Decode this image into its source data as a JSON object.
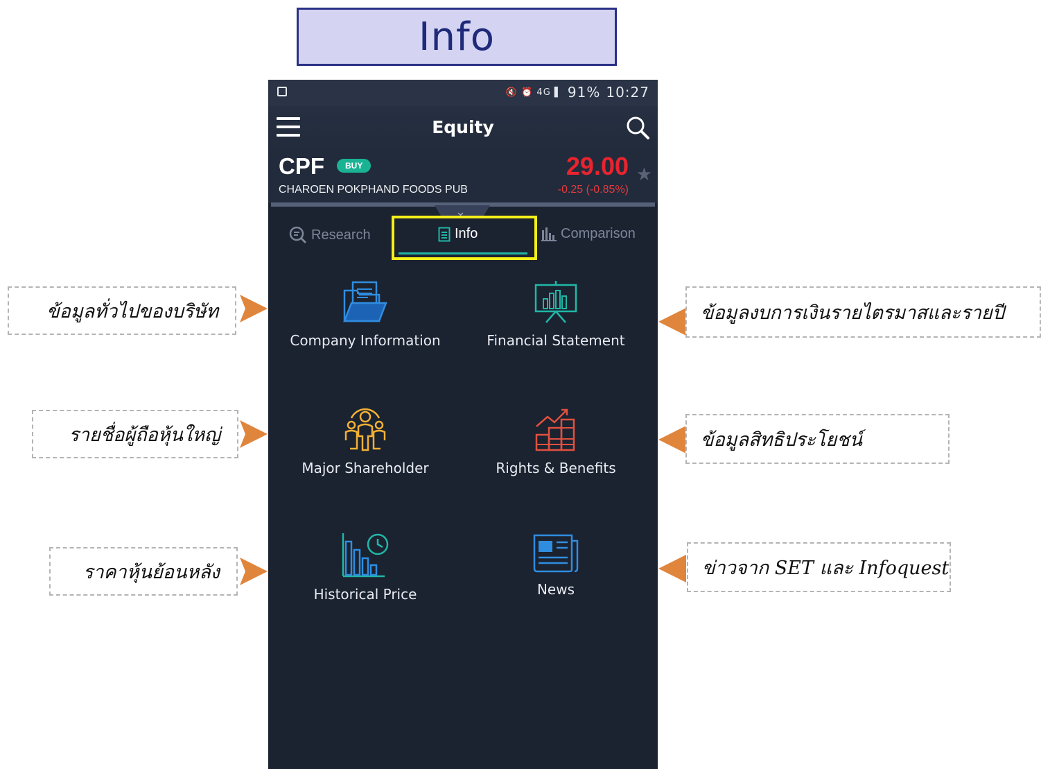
{
  "banner": {
    "title": "Info"
  },
  "status_bar": {
    "icons": "🔇 ⏰ 4G ▌",
    "battery": "91%",
    "time": "10:27"
  },
  "header": {
    "title": "Equity"
  },
  "stock": {
    "ticker": "CPF",
    "badge": "BUY",
    "company": "CHAROEN POKPHAND FOODS PUB",
    "price": "29.00",
    "change": "-0.25 (-0.85%)"
  },
  "tabs": [
    {
      "label": "Research",
      "icon": "search-icon"
    },
    {
      "label": "Info",
      "icon": "document-icon"
    },
    {
      "label": "Comparison",
      "icon": "bar-chart-icon"
    }
  ],
  "tiles": {
    "company_information": "Company Information",
    "financial_statement": "Financial Statement",
    "major_shareholder": "Major Shareholder",
    "rights_benefits": "Rights & Benefits",
    "historical_price": "Historical Price",
    "news": "News"
  },
  "annotations": {
    "company_info": "ข้อมูลทั่วไปของบริษัท",
    "shareholder": "รายชื่อผู้ถือหุ้นใหญ่",
    "historical": "ราคาหุ้นย้อนหลัง",
    "financial": "ข้อมูลงบการเงินรายไตรมาสและรายปี",
    "rights": "ข้อมูลสิทธิประโยชน์",
    "news": "ข่าวจาก SET และ Infoquest"
  },
  "colors": {
    "background": "#1b2230",
    "price_red": "#e8242f",
    "buy_badge": "#19b394",
    "highlight": "#f5ef1a",
    "arrow": "#e0853c",
    "icon_blue": "#2f8de0",
    "icon_teal": "#21b7a7",
    "icon_orange": "#f2b135",
    "icon_red": "#e0513e"
  }
}
